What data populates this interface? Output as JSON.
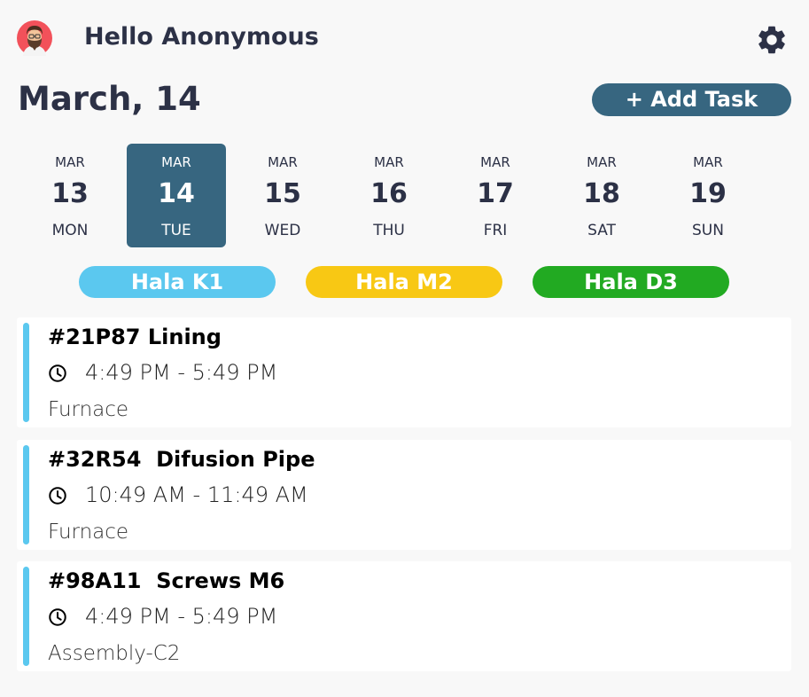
{
  "header": {
    "greeting": "Hello Anonymous",
    "avatar_icon": "bearded-man-avatar",
    "settings_icon": "gear-icon"
  },
  "date_title": "March, 14",
  "add_task_label": "+ Add Task",
  "colors": {
    "primary": "#376680",
    "text": "#2c3146",
    "accent_bar": "#5bc8ef"
  },
  "week": [
    {
      "month": "MAR",
      "day": "13",
      "weekday": "MON",
      "selected": false
    },
    {
      "month": "MAR",
      "day": "14",
      "weekday": "TUE",
      "selected": true
    },
    {
      "month": "MAR",
      "day": "15",
      "weekday": "WED",
      "selected": false
    },
    {
      "month": "MAR",
      "day": "16",
      "weekday": "THU",
      "selected": false
    },
    {
      "month": "MAR",
      "day": "17",
      "weekday": "FRI",
      "selected": false
    },
    {
      "month": "MAR",
      "day": "18",
      "weekday": "SAT",
      "selected": false
    },
    {
      "month": "MAR",
      "day": "19",
      "weekday": "SUN",
      "selected": false
    }
  ],
  "halls": [
    {
      "label": "Hala K1",
      "color": "#5bc8ef"
    },
    {
      "label": "Hala M2",
      "color": "#f8c814"
    },
    {
      "label": "Hala D3",
      "color": "#22aa22"
    }
  ],
  "tasks": [
    {
      "title": "#21P87 Lining",
      "time": "4:49 PM - 5:49 PM",
      "location": "Furnace"
    },
    {
      "title": "#32R54  Difusion Pipe",
      "time": "10:49 AM - 11:49 AM",
      "location": "Furnace"
    },
    {
      "title": "#98A11  Screws M6",
      "time": "4:49 PM - 5:49 PM",
      "location": "Assembly-C2"
    }
  ]
}
